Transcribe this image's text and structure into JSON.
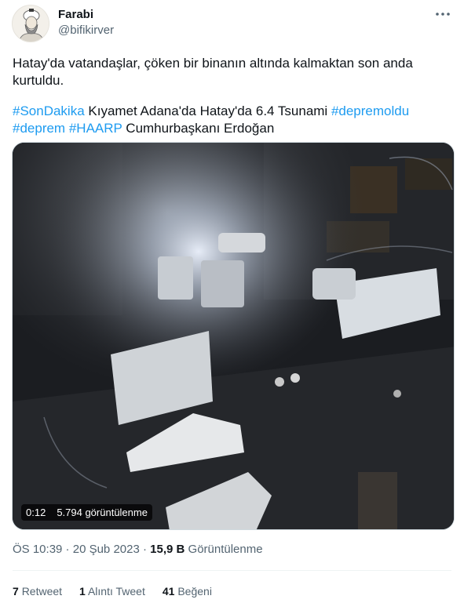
{
  "author": {
    "name": "Farabi",
    "handle": "@bifikirver"
  },
  "tweet": {
    "line1": "Hatay'da vatandaşlar, çöken bir binanın altında kalmaktan son anda kurtuldu.",
    "hashtag1": "#SonDakika",
    "text1": " Kıyamet Adana'da Hatay'da 6.4 Tsunami ",
    "hashtag2": "#depremoldu",
    "hashtag3": "#deprem",
    "space": " ",
    "hashtag4": "#HAARP",
    "text2": " Cumhurbaşkanı Erdoğan"
  },
  "video": {
    "duration": "0:12",
    "views": "5.794 görüntülenme"
  },
  "meta": {
    "time": "ÖS 10:39",
    "sep1": " · ",
    "date": "20 Şub 2023",
    "sep2": " · ",
    "views_count": "15,9 B",
    "views_label": " Görüntülenme"
  },
  "stats": {
    "retweets_count": "7",
    "retweets_label": "Retweet",
    "quotes_count": "1",
    "quotes_label": "Alıntı Tweet",
    "likes_count": "41",
    "likes_label": "Beğeni"
  },
  "colors": {
    "link": "#1d9bf0",
    "text": "#0f1419",
    "muted": "#536471"
  },
  "icons": {
    "more": "more-horizontal-icon"
  }
}
